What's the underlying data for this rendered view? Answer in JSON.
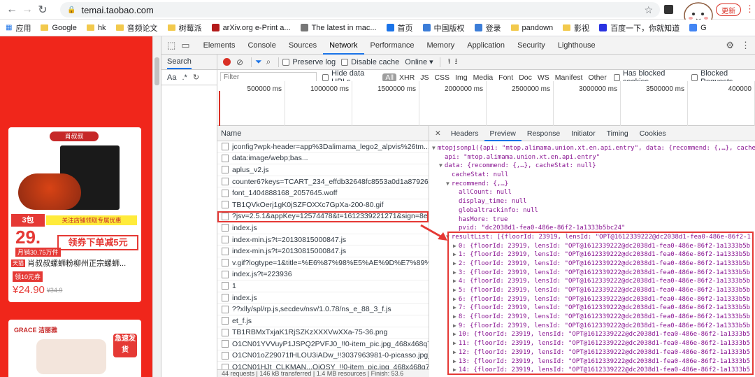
{
  "browser": {
    "url": "temai.taobao.com",
    "update_label": "更新",
    "bookmarks": [
      {
        "label": "应用",
        "icon": "apps-grid-icon"
      },
      {
        "label": "Google",
        "icon": "folder-icon"
      },
      {
        "label": "hk",
        "icon": "folder-icon"
      },
      {
        "label": "音频论文",
        "icon": "folder-icon"
      },
      {
        "label": "树莓派",
        "icon": "folder-icon"
      },
      {
        "label": "arXiv.org e-Print a...",
        "icon": "arxiv-icon"
      },
      {
        "label": "The latest in mac...",
        "icon": "page-icon"
      },
      {
        "label": "首页",
        "icon": "globe-icon"
      },
      {
        "label": "中国版权",
        "icon": "c-icon"
      },
      {
        "label": "登录",
        "icon": "c-icon"
      },
      {
        "label": "pandown",
        "icon": "folder-icon"
      },
      {
        "label": "影视",
        "icon": "folder-icon"
      },
      {
        "label": "百度一下，你就知道",
        "icon": "paw-icon"
      },
      {
        "label": "G",
        "icon": "google-icon"
      }
    ]
  },
  "shop": {
    "brand": "肖叔叔",
    "badge": "3包",
    "promo_line": "关注店铺领取专属优惠",
    "price_big": "29.",
    "coupon_text": "领券下单减5元",
    "monthly_sales": "月销30.75万件",
    "tmall": "天猫",
    "product_title": "肖叔叔螺蛳粉柳州正宗螺蛳...",
    "coupon_badge": "领10元券",
    "price": "¥24.90",
    "old_price": "¥34.9",
    "brand2": "GRACE 洁丽雅",
    "ship_tag": "急速发货"
  },
  "devtools": {
    "tabs": [
      "Elements",
      "Console",
      "Sources",
      "Network",
      "Performance",
      "Memory",
      "Application",
      "Security",
      "Lighthouse"
    ],
    "active_tab": "Network",
    "search_label": "Search",
    "preserve_log": "Preserve log",
    "disable_cache": "Disable cache",
    "throttle": "Online",
    "filter_placeholder": "Filter",
    "hide_data_urls": "Hide data URLs",
    "type_filters": [
      "All",
      "XHR",
      "JS",
      "CSS",
      "Img",
      "Media",
      "Font",
      "Doc",
      "WS",
      "Manifest",
      "Other"
    ],
    "has_blocked_cookies": "Has blocked cookies",
    "blocked_requests": "Blocked Requests",
    "timeline_ticks": [
      "500000 ms",
      "1000000 ms",
      "1500000 ms",
      "2000000 ms",
      "2500000 ms",
      "3000000 ms",
      "3500000 ms",
      "400000"
    ],
    "name_header": "Name",
    "requests": [
      "jconfig?wpk-header=app%3Dalimama_lego2_alpvis%26tm...3D0",
      "data:image/webp;bas...",
      "aplus_v2.js",
      "counter6?keys=TCART_234_effdb32648fc8553a0d1a87926...q&t.",
      "font_1404888168_2057645.woff",
      "TB1QVkOerj1gK0jSZFOXXc7GpXa-200-80.gif",
      "?jsv=2.5.1&appKey=12574478&t=1612339221271&sign=8e...3A",
      "index.js",
      "index-min.js?t=20130815000847.js",
      "index-min.js?t=20130815000847.js",
      "v.gif?logtype=1&title=%E6%87%98%E5%AE%9D%E7%89%89%...",
      "index.js?t=223936",
      "1",
      "index.js",
      "??xlly/spl/rp.js,secdev/nsv/1.0.78/ns_e_88_3_f.js",
      "et_f.js",
      "TB1RBMxTxjaK1RjSZKzXXXVwXXa-75-36.png",
      "O1CN01YVVuyP1JSPQ2PVFJ0_!!0-item_pic.jpg_468x468q75.jpg_.",
      "O1CN01oZ29071fHLOU3iADw_!!3037963981-0-picasso.jpg_468x",
      "O1CN01HJt_CLKMAN...OiOSY_!!0-item_pic.jpg_468x468q75..."
    ],
    "selected_request_index": 6,
    "status_text": "44 requests | 146 kB transferred | 1.4 MB resources | Finish: 53.6",
    "preview_tabs": [
      "Headers",
      "Preview",
      "Response",
      "Initiator",
      "Timing",
      "Cookies"
    ],
    "active_preview_tab": "Preview",
    "json_lines": [
      {
        "indent": 0,
        "caret": "▼",
        "text": "mtopjsonp1({api: \"mtop.alimama.union.xt.en.api.entry\", data: {recommend: {,…}, cache"
      },
      {
        "indent": 1,
        "caret": "",
        "text": "api: \"mtop.alimama.union.xt.en.api.entry\""
      },
      {
        "indent": 1,
        "caret": "▼",
        "text": "data: {recommend: {,…}, cacheStat: null}"
      },
      {
        "indent": 2,
        "caret": "",
        "text": "cacheStat: null"
      },
      {
        "indent": 2,
        "caret": "▼",
        "text": "recommend: {,…}"
      },
      {
        "indent": 3,
        "caret": "",
        "text": "allCount: null"
      },
      {
        "indent": 3,
        "caret": "",
        "text": "display_time: null"
      },
      {
        "indent": 3,
        "caret": "",
        "text": "globaltrackinfo: null"
      },
      {
        "indent": 3,
        "caret": "",
        "text": "hasMore: true"
      },
      {
        "indent": 3,
        "caret": "",
        "text": "pvid: \"dc2038d1-fea0-486e-86f2-1a1333b5bc24\""
      },
      {
        "indent": 2,
        "caret": "▼",
        "text": "resultList: [{floorId: 23919, lensId: \"OPT@1612339222@dc2038d1-fea0-486e-86f2-1"
      },
      {
        "indent": 3,
        "caret": "▶",
        "text": "0: {floorId: 23919, lensId: \"OPT@1612339222@dc2038d1-fea0-486e-86f2-1a1333b5b"
      },
      {
        "indent": 3,
        "caret": "▶",
        "text": "1: {floorId: 23919, lensId: \"OPT@1612339222@dc2038d1-fea0-486e-86f2-1a1333b5b"
      },
      {
        "indent": 3,
        "caret": "▶",
        "text": "2: {floorId: 23919, lensId: \"OPT@1612339222@dc2038d1-fea0-486e-86f2-1a1333b5b"
      },
      {
        "indent": 3,
        "caret": "▶",
        "text": "3: {floorId: 23919, lensId: \"OPT@1612339222@dc2038d1-fea0-486e-86f2-1a1333b5b"
      },
      {
        "indent": 3,
        "caret": "▶",
        "text": "4: {floorId: 23919, lensId: \"OPT@1612339222@dc2038d1-fea0-486e-86f2-1a1333b5b"
      },
      {
        "indent": 3,
        "caret": "▶",
        "text": "5: {floorId: 23919, lensId: \"OPT@1612339222@dc2038d1-fea0-486e-86f2-1a1333b5b"
      },
      {
        "indent": 3,
        "caret": "▶",
        "text": "6: {floorId: 23919, lensId: \"OPT@1612339222@dc2038d1-fea0-486e-86f2-1a1333b5b"
      },
      {
        "indent": 3,
        "caret": "▶",
        "text": "7: {floorId: 23919, lensId: \"OPT@1612339222@dc2038d1-fea0-486e-86f2-1a1333b5b"
      },
      {
        "indent": 3,
        "caret": "▶",
        "text": "8: {floorId: 23919, lensId: \"OPT@1612339222@dc2038d1-fea0-486e-86f2-1a1333b5b"
      },
      {
        "indent": 3,
        "caret": "▶",
        "text": "9: {floorId: 23919, lensId: \"OPT@1612339222@dc2038d1-fea0-486e-86f2-1a1333b5b"
      },
      {
        "indent": 3,
        "caret": "▶",
        "text": "10: {floorId: 23919, lensId: \"OPT@1612339222@dc2038d1-fea0-486e-86f2-1a1333b5"
      },
      {
        "indent": 3,
        "caret": "▶",
        "text": "11: {floorId: 23919, lensId: \"OPT@1612339222@dc2038d1-fea0-486e-86f2-1a1333b5"
      },
      {
        "indent": 3,
        "caret": "▶",
        "text": "12: {floorId: 23919, lensId: \"OPT@1612339222@dc2038d1-fea0-486e-86f2-1a1333b5"
      },
      {
        "indent": 3,
        "caret": "▶",
        "text": "13: {floorId: 23919, lensId: \"OPT@1612339222@dc2038d1-fea0-486e-86f2-1a1333b5"
      },
      {
        "indent": 3,
        "caret": "▶",
        "text": "14: {floorId: 23919, lensId: \"OPT@1612339222@dc2038d1-fea0-486e-86f2-1a1333b5"
      }
    ]
  },
  "colors": {
    "accent": "#1a73e8",
    "highlight": "#e53935",
    "shop_red": "#f0261b"
  }
}
